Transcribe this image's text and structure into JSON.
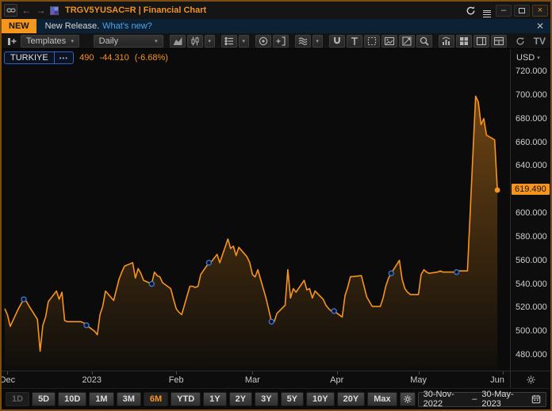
{
  "window": {
    "title": "TRGV5YUSAC=R | Financial Chart"
  },
  "notification": {
    "badge": "NEW",
    "message": "New Release.",
    "link": "What's new?"
  },
  "toolbar": {
    "templates_label": "Templates",
    "interval_label": "Daily",
    "tv_logo": "TV"
  },
  "legend": {
    "name": "TURKIYE",
    "more": "•••",
    "value_visible": "490",
    "change": "-44.310",
    "change_pct": "(-6.68%)"
  },
  "axis": {
    "currency": "USD",
    "last_price_label": "619.490"
  },
  "bottom": {
    "periods": [
      {
        "label": "1D",
        "state": "disabled"
      },
      {
        "label": "5D",
        "state": "normal"
      },
      {
        "label": "10D",
        "state": "normal"
      },
      {
        "label": "1M",
        "state": "normal"
      },
      {
        "label": "3M",
        "state": "normal"
      },
      {
        "label": "6M",
        "state": "active"
      },
      {
        "label": "YTD",
        "state": "normal"
      },
      {
        "label": "1Y",
        "state": "normal"
      },
      {
        "label": "2Y",
        "state": "normal"
      },
      {
        "label": "3Y",
        "state": "normal"
      },
      {
        "label": "5Y",
        "state": "normal"
      },
      {
        "label": "10Y",
        "state": "normal"
      },
      {
        "label": "20Y",
        "state": "normal"
      },
      {
        "label": "Max",
        "state": "normal"
      }
    ],
    "range_start": "30-Nov-2022",
    "range_separator": "–",
    "range_end": "30-May-2023"
  },
  "chart_data": {
    "type": "area",
    "name": "TURKIYE",
    "unit": "USD",
    "interval": "Daily",
    "line_color": "#f7941d",
    "marker_color": "#3f74cf",
    "x_domain": [
      "2022-11-30",
      "2023-06-01"
    ],
    "ylim": [
      466.6,
      738.8
    ],
    "y_ticks": [
      480,
      500,
      520,
      540,
      560,
      580,
      600,
      620,
      640,
      660,
      680,
      700,
      720
    ],
    "x_ticks": [
      {
        "label": "Dec",
        "date": "2022-12-01"
      },
      {
        "label": "2023",
        "date": "2023-01-01"
      },
      {
        "label": "Feb",
        "date": "2023-02-01"
      },
      {
        "label": "Mar",
        "date": "2023-03-01"
      },
      {
        "label": "Apr",
        "date": "2023-04-01"
      },
      {
        "label": "May",
        "date": "2023-05-01"
      },
      {
        "label": "Jun",
        "date": "2023-06-01"
      }
    ],
    "last_price": 619.49,
    "change": -44.31,
    "change_pct": -6.68,
    "event_marker_dates": [
      "2022-12-07",
      "2022-12-30",
      "2023-01-23",
      "2023-02-13",
      "2023-03-08",
      "2023-03-31",
      "2023-04-21",
      "2023-05-15"
    ],
    "points": [
      [
        "2022-11-30",
        519
      ],
      [
        "2022-12-01",
        514
      ],
      [
        "2022-12-02",
        504
      ],
      [
        "2022-12-05",
        519
      ],
      [
        "2022-12-07",
        527
      ],
      [
        "2022-12-08",
        525
      ],
      [
        "2022-12-09",
        521
      ],
      [
        "2022-12-12",
        510
      ],
      [
        "2022-12-13",
        483
      ],
      [
        "2022-12-14",
        505
      ],
      [
        "2022-12-15",
        512
      ],
      [
        "2022-12-16",
        525
      ],
      [
        "2022-12-19",
        534
      ],
      [
        "2022-12-20",
        527
      ],
      [
        "2022-12-21",
        533
      ],
      [
        "2022-12-22",
        509
      ],
      [
        "2022-12-23",
        508
      ],
      [
        "2022-12-27",
        508
      ],
      [
        "2022-12-28",
        508
      ],
      [
        "2022-12-29",
        507
      ],
      [
        "2022-12-30",
        505
      ],
      [
        "2023-01-02",
        500
      ],
      [
        "2023-01-03",
        497
      ],
      [
        "2023-01-04",
        514
      ],
      [
        "2023-01-05",
        521
      ],
      [
        "2023-01-06",
        534
      ],
      [
        "2023-01-09",
        526
      ],
      [
        "2023-01-10",
        535
      ],
      [
        "2023-01-11",
        544
      ],
      [
        "2023-01-12",
        550
      ],
      [
        "2023-01-13",
        555
      ],
      [
        "2023-01-16",
        558
      ],
      [
        "2023-01-17",
        545
      ],
      [
        "2023-01-18",
        553
      ],
      [
        "2023-01-19",
        549
      ],
      [
        "2023-01-20",
        543
      ],
      [
        "2023-01-23",
        540
      ],
      [
        "2023-01-24",
        550
      ],
      [
        "2023-01-25",
        547
      ],
      [
        "2023-01-26",
        546
      ],
      [
        "2023-01-27",
        541
      ],
      [
        "2023-01-30",
        536
      ],
      [
        "2023-01-31",
        527
      ],
      [
        "2023-02-01",
        519
      ],
      [
        "2023-02-02",
        516
      ],
      [
        "2023-02-03",
        514
      ],
      [
        "2023-02-06",
        538
      ],
      [
        "2023-02-07",
        538
      ],
      [
        "2023-02-08",
        537
      ],
      [
        "2023-02-09",
        538
      ],
      [
        "2023-02-10",
        548
      ],
      [
        "2023-02-13",
        558
      ],
      [
        "2023-02-14",
        559
      ],
      [
        "2023-02-15",
        562
      ],
      [
        "2023-02-16",
        565
      ],
      [
        "2023-02-17",
        558
      ],
      [
        "2023-02-20",
        578
      ],
      [
        "2023-02-21",
        570
      ],
      [
        "2023-02-22",
        572
      ],
      [
        "2023-02-23",
        564
      ],
      [
        "2023-02-24",
        571
      ],
      [
        "2023-02-27",
        563
      ],
      [
        "2023-02-28",
        558
      ],
      [
        "2023-03-01",
        548
      ],
      [
        "2023-03-02",
        546
      ],
      [
        "2023-03-03",
        552
      ],
      [
        "2023-03-06",
        528
      ],
      [
        "2023-03-07",
        518
      ],
      [
        "2023-03-08",
        508
      ],
      [
        "2023-03-09",
        508
      ],
      [
        "2023-03-10",
        515
      ],
      [
        "2023-03-13",
        522
      ],
      [
        "2023-03-14",
        552
      ],
      [
        "2023-03-15",
        528
      ],
      [
        "2023-03-16",
        536
      ],
      [
        "2023-03-17",
        533
      ],
      [
        "2023-03-20",
        543
      ],
      [
        "2023-03-21",
        535
      ],
      [
        "2023-03-22",
        536
      ],
      [
        "2023-03-23",
        528
      ],
      [
        "2023-03-24",
        534
      ],
      [
        "2023-03-27",
        527
      ],
      [
        "2023-03-28",
        522
      ],
      [
        "2023-03-29",
        519
      ],
      [
        "2023-03-30",
        517
      ],
      [
        "2023-03-31",
        517
      ],
      [
        "2023-04-03",
        512
      ],
      [
        "2023-04-04",
        530
      ],
      [
        "2023-04-05",
        537
      ],
      [
        "2023-04-06",
        546
      ],
      [
        "2023-04-10",
        547
      ],
      [
        "2023-04-11",
        538
      ],
      [
        "2023-04-12",
        529
      ],
      [
        "2023-04-13",
        525
      ],
      [
        "2023-04-14",
        521
      ],
      [
        "2023-04-17",
        521
      ],
      [
        "2023-04-18",
        528
      ],
      [
        "2023-04-19",
        538
      ],
      [
        "2023-04-20",
        545
      ],
      [
        "2023-04-21",
        549
      ],
      [
        "2023-04-24",
        560
      ],
      [
        "2023-04-25",
        544
      ],
      [
        "2023-04-26",
        536
      ],
      [
        "2023-04-27",
        533
      ],
      [
        "2023-04-28",
        531
      ],
      [
        "2023-05-01",
        531
      ],
      [
        "2023-05-02",
        548
      ],
      [
        "2023-05-03",
        552
      ],
      [
        "2023-05-04",
        550
      ],
      [
        "2023-05-05",
        549
      ],
      [
        "2023-05-08",
        550
      ],
      [
        "2023-05-09",
        551
      ],
      [
        "2023-05-10",
        550
      ],
      [
        "2023-05-11",
        550
      ],
      [
        "2023-05-12",
        550
      ],
      [
        "2023-05-15",
        550
      ],
      [
        "2023-05-16",
        551
      ],
      [
        "2023-05-17",
        551
      ],
      [
        "2023-05-18",
        551
      ],
      [
        "2023-05-19",
        551
      ],
      [
        "2023-05-22",
        699
      ],
      [
        "2023-05-23",
        694
      ],
      [
        "2023-05-24",
        675
      ],
      [
        "2023-05-25",
        680
      ],
      [
        "2023-05-26",
        666
      ],
      [
        "2023-05-29",
        662
      ],
      [
        "2023-05-30",
        619.49
      ]
    ]
  }
}
